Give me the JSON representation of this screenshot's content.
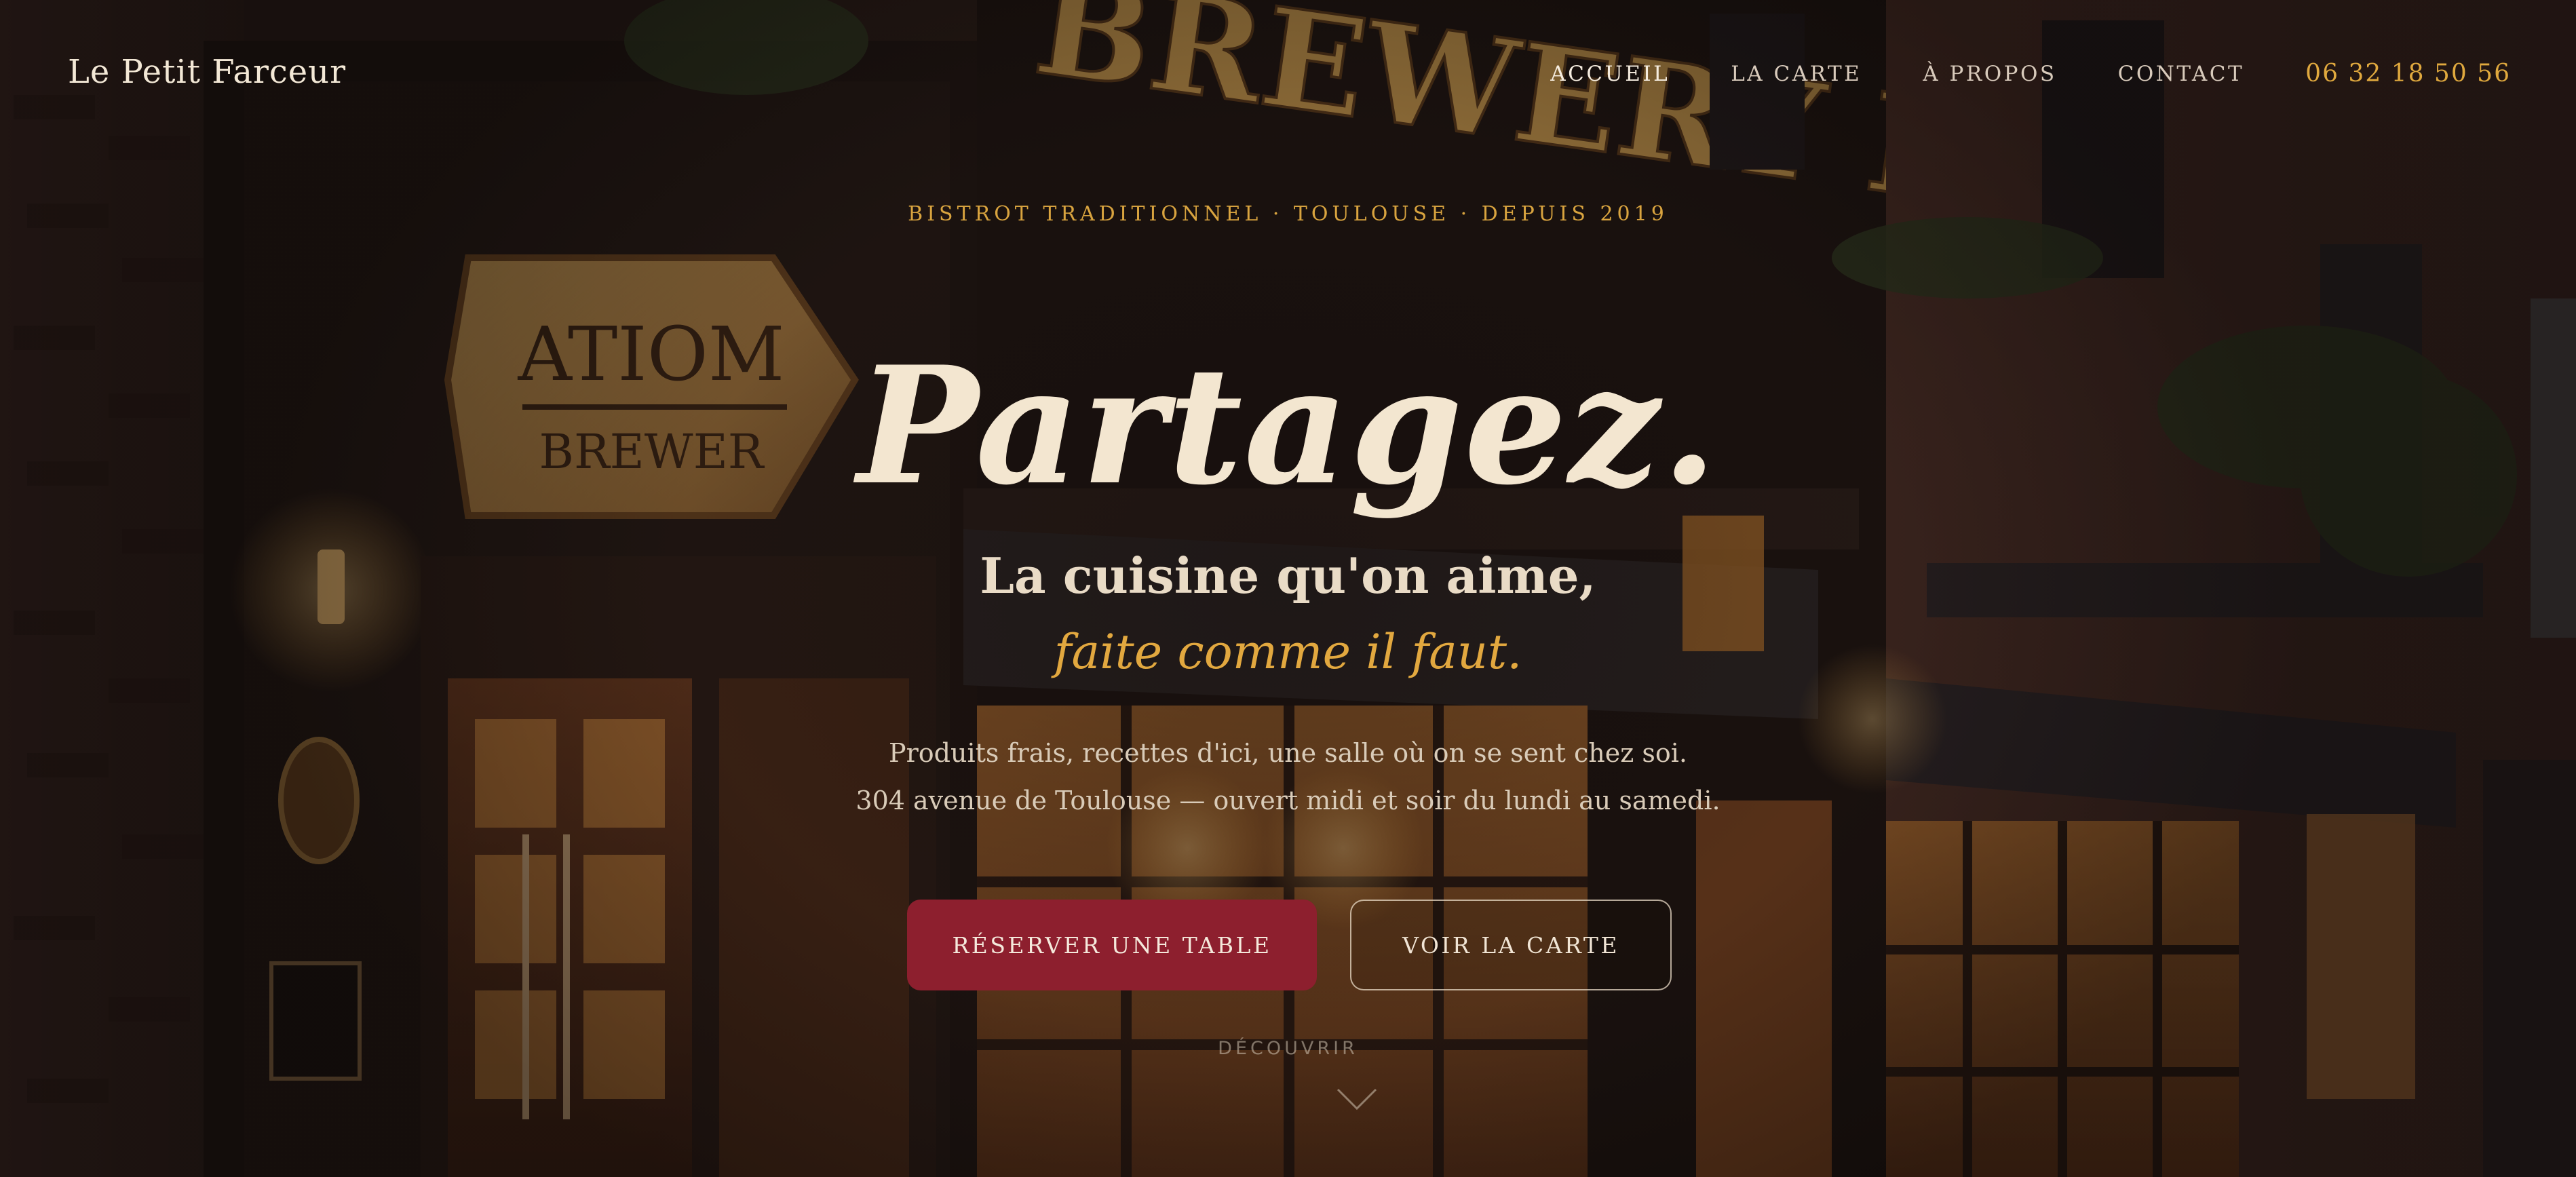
{
  "header": {
    "brand": "Le Petit Farceur",
    "nav": [
      {
        "label": "ACCUEIL",
        "active": true
      },
      {
        "label": "LA CARTE",
        "active": false
      },
      {
        "label": "À PROPOS",
        "active": false
      },
      {
        "label": "CONTACT",
        "active": false
      }
    ],
    "phone": "06 32 18 50 56"
  },
  "hero": {
    "eyebrow": "BISTROT TRADITIONNEL · TOULOUSE · DEPUIS 2019",
    "headline": "Partagez.",
    "subhead": "La cuisine qu'on aime,",
    "subhead_accent": "faite comme il faut.",
    "description_line1": "Produits frais, recettes d'ici, une salle où on se sent chez soi.",
    "description_line2": "304 avenue de Toulouse — ouvert midi et soir du lundi au samedi.",
    "primary_cta": "RÉSERVER UNE TABLE",
    "secondary_cta": "VOIR LA CARTE",
    "scroll_hint": "DÉCOUVRIR"
  },
  "background": {
    "sign_text": "BREWERY RESTAURANT",
    "plaque_line1": "ATIOM",
    "plaque_line2": "BREWER"
  },
  "colors": {
    "accent_gold": "#e0a93e",
    "primary_button": "#8d1f2e",
    "cream_text": "#f3e6d0"
  },
  "icons": {
    "scroll_arrow": "chevron-down-icon"
  }
}
